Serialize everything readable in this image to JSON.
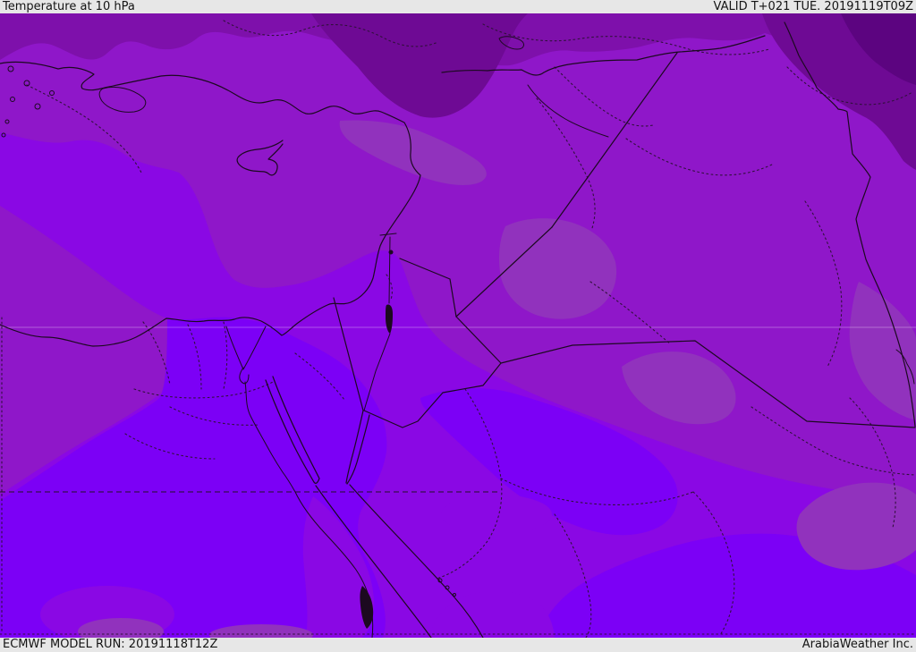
{
  "header": {
    "title": "Temperature at 10 hPa",
    "valid_time": "VALID T+021 TUE. 20191119T09Z"
  },
  "footer": {
    "model_run": "ECMWF MODEL RUN: 20191118T12Z",
    "attribution": "ArabiaWeather Inc."
  },
  "map": {
    "colors": {
      "bar_bg": "#e7e7e7",
      "bar_text": "#141414",
      "darkest": "#5c0480",
      "very_dark": "#6e0a94",
      "dark_band": "#7e10ab",
      "mid_purple": "#8f17c9",
      "mauve": "#9132bd",
      "violet": "#8a08e4",
      "bright_violet": "#7c00f6",
      "line": "#1c0920"
    }
  }
}
